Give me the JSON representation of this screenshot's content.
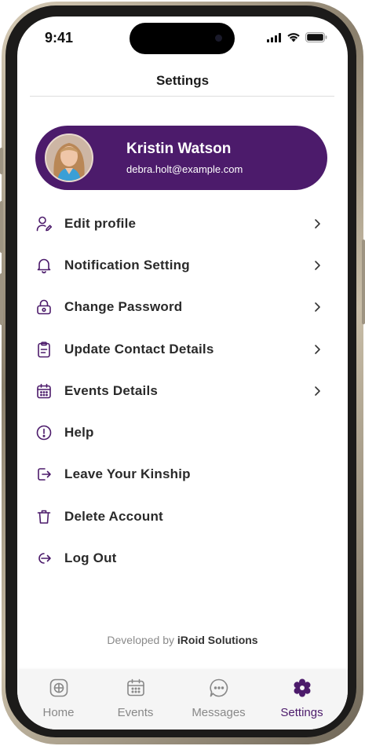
{
  "status_bar": {
    "time": "9:41"
  },
  "header": {
    "title": "Settings"
  },
  "profile": {
    "name": "Kristin Watson",
    "email": "debra.holt@example.com"
  },
  "menu": [
    {
      "label": "Edit profile",
      "icon": "user-edit-icon",
      "chevron": true
    },
    {
      "label": "Notification Setting",
      "icon": "bell-icon",
      "chevron": true
    },
    {
      "label": "Change Password",
      "icon": "lock-icon",
      "chevron": true
    },
    {
      "label": "Update Contact Details",
      "icon": "clipboard-icon",
      "chevron": true
    },
    {
      "label": "Events Details",
      "icon": "calendar-icon",
      "chevron": true
    },
    {
      "label": "Help",
      "icon": "info-circle-icon",
      "chevron": false
    },
    {
      "label": "Leave Your Kinship",
      "icon": "exit-icon",
      "chevron": false
    },
    {
      "label": "Delete Account",
      "icon": "trash-icon",
      "chevron": false
    },
    {
      "label": "Log Out",
      "icon": "logout-icon",
      "chevron": false
    }
  ],
  "footer": {
    "credit_prefix": "Developed by",
    "credit_company": "iRoid Solutions"
  },
  "tabbar": {
    "tabs": [
      {
        "label": "Home",
        "icon": "home-icon",
        "active": false
      },
      {
        "label": "Events",
        "icon": "calendar-icon",
        "active": false
      },
      {
        "label": "Messages",
        "icon": "chat-icon",
        "active": false
      },
      {
        "label": "Settings",
        "icon": "gear-icon",
        "active": true
      }
    ]
  },
  "colors": {
    "accent": "#4c1b6b",
    "tab_inactive": "#888888",
    "text": "#2a2a2a"
  }
}
